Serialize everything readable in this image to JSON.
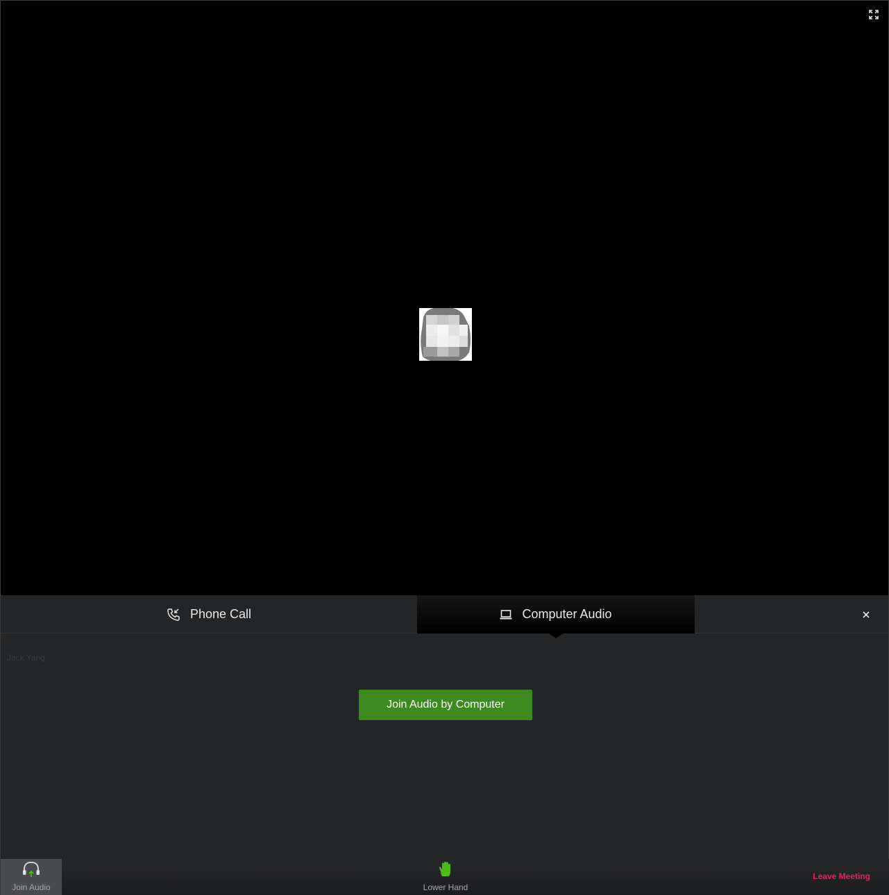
{
  "video": {
    "fullscreen_icon": "fullscreen-icon"
  },
  "audio_panel": {
    "tabs": [
      {
        "label": "Phone Call",
        "icon": "phone-call-icon"
      },
      {
        "label": "Computer Audio",
        "icon": "laptop-icon"
      }
    ],
    "active_tab": "Computer Audio",
    "close_icon": "close-icon",
    "participant_name": "Jack Yang",
    "join_button_label": "Join Audio by Computer",
    "accent_color": "#3d8b1e"
  },
  "toolbar": {
    "join_audio_label": "Join Audio",
    "lower_hand_label": "Lower Hand",
    "leave_label": "Leave Meeting",
    "leave_color": "#e0245e",
    "hand_color": "#4cbb17"
  }
}
